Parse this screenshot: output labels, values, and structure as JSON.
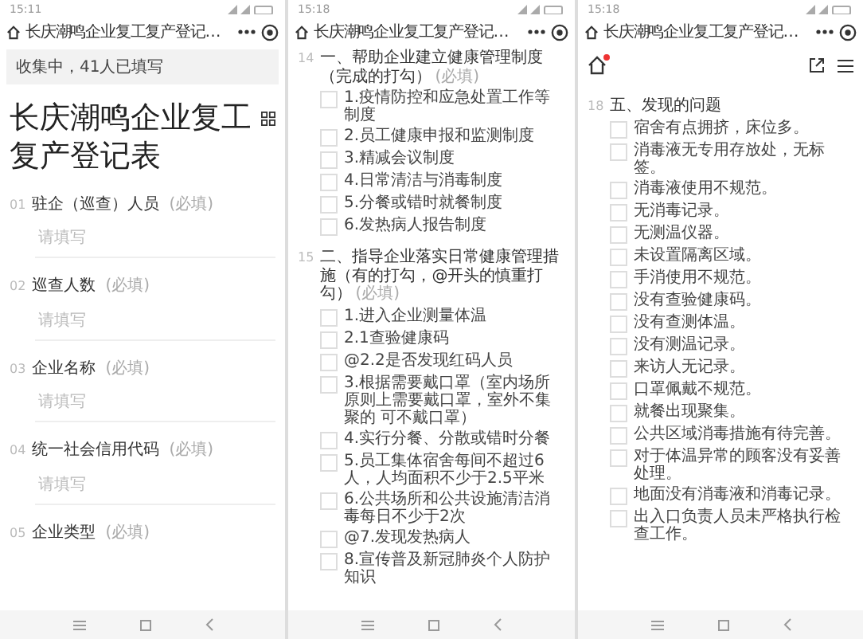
{
  "screens": [
    {
      "kind": "form_start",
      "status_time": "15:11",
      "nav_title": "长庆潮鸣企业复工复产登记…",
      "banner": "收集中，41人已填写",
      "form_title": "长庆潮鸣企业复工复产登记表",
      "questions": [
        {
          "number": "01",
          "label": "驻企（巡查）人员",
          "required": "(必填)",
          "placeholder": "请填写"
        },
        {
          "number": "02",
          "label": "巡查人数",
          "required": "(必填)",
          "placeholder": "请填写"
        },
        {
          "number": "03",
          "label": "企业名称",
          "required": "(必填)",
          "placeholder": "请填写"
        },
        {
          "number": "04",
          "label": "统一社会信用代码",
          "required": "(必填)",
          "placeholder": "请填写"
        },
        {
          "number": "05",
          "label": "企业类型",
          "required": "(必填)"
        }
      ]
    },
    {
      "kind": "checklist",
      "status_time": "15:18",
      "nav_title": "长庆潮鸣企业复工复产登记…",
      "questions": [
        {
          "number": "14",
          "label": "一、帮助企业建立健康管理制度（完成的打勾）",
          "required": "(必填)",
          "options": [
            {
              "label": "1.疫情防控和应急处置工作等制度",
              "checked": false
            },
            {
              "label": "2.员工健康申报和监测制度",
              "checked": false
            },
            {
              "label": "3.精减会议制度",
              "checked": false
            },
            {
              "label": "4.日常清洁与消毒制度",
              "checked": false
            },
            {
              "label": "5.分餐或错时就餐制度",
              "checked": false
            },
            {
              "label": "6.发热病人报告制度",
              "checked": false
            }
          ]
        },
        {
          "number": "15",
          "label": "二、指导企业落实日常健康管理措施（有的打勾，@开头的慎重打勾）",
          "required": "(必填)",
          "options": [
            {
              "label": "1.进入企业测量体温",
              "checked": false
            },
            {
              "label": "2.1查验健康码",
              "checked": false
            },
            {
              "label": "@2.2是否发现红码人员",
              "checked": false
            },
            {
              "label": "3.根据需要戴口罩（室内场所原则上需要戴口罩，室外不集聚的 可不戴口罩）",
              "checked": false
            },
            {
              "label": "4.实行分餐、分散或错时分餐",
              "checked": false
            },
            {
              "label": "5.员工集体宿舍每间不超过6人，人均面积不少于2.5平米",
              "checked": false
            },
            {
              "label": "6.公共场所和公共设施清洁消毒每日不少于2次",
              "checked": false
            },
            {
              "label": "@7.发现发热病人",
              "checked": false
            },
            {
              "label": "8.宣传普及新冠肺炎个人防护知识",
              "checked": false
            }
          ]
        }
      ]
    },
    {
      "kind": "checklist_toolbar",
      "status_time": "15:18",
      "nav_title": "长庆潮鸣企业复工复产登记…",
      "home_badge": true,
      "questions": [
        {
          "number": "18",
          "label": "五、发现的问题",
          "options": [
            {
              "label": "宿舍有点拥挤，床位多。",
              "checked": false
            },
            {
              "label": "消毒液无专用存放处，无标签。",
              "checked": false
            },
            {
              "label": "消毒液使用不规范。",
              "checked": false
            },
            {
              "label": "无消毒记录。",
              "checked": false
            },
            {
              "label": "无测温仪器。",
              "checked": false
            },
            {
              "label": "未设置隔离区域。",
              "checked": false
            },
            {
              "label": "手消使用不规范。",
              "checked": false
            },
            {
              "label": "没有查验健康码。",
              "checked": false
            },
            {
              "label": "没有查测体温。",
              "checked": false
            },
            {
              "label": "没有测温记录。",
              "checked": false
            },
            {
              "label": "来访人无记录。",
              "checked": false
            },
            {
              "label": "口罩佩戴不规范。",
              "checked": false
            },
            {
              "label": "就餐出现聚集。",
              "checked": false
            },
            {
              "label": "公共区域消毒措施有待完善。",
              "checked": false
            },
            {
              "label": "对于体温异常的顾客没有妥善处理。",
              "checked": false
            },
            {
              "label": "地面没有消毒液和消毒记录。",
              "checked": false
            },
            {
              "label": "出入口负责人员未严格执行检查工作。",
              "checked": false
            }
          ]
        }
      ]
    }
  ]
}
